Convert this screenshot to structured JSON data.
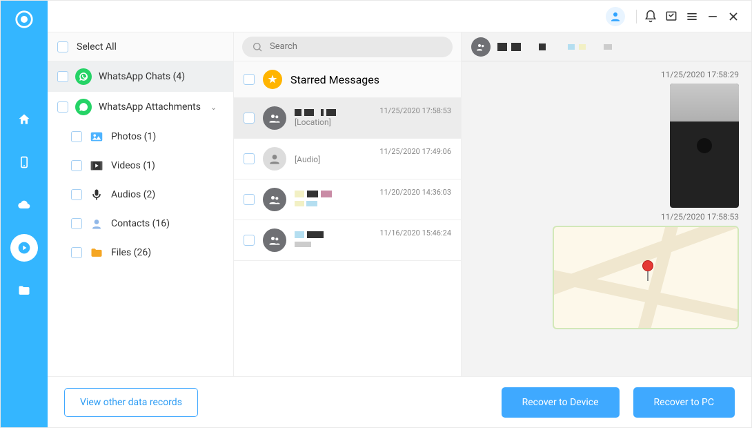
{
  "sidebar": {
    "select_all": "Select All",
    "categories": [
      {
        "label": "WhatsApp Chats (4)",
        "icon": "whatsapp"
      },
      {
        "label": "WhatsApp Attachments",
        "icon": "whatsapp",
        "expandable": true
      }
    ],
    "attachments": [
      {
        "label": "Photos (1)",
        "icon": "photos"
      },
      {
        "label": "Videos (1)",
        "icon": "videos"
      },
      {
        "label": "Audios (2)",
        "icon": "audios"
      },
      {
        "label": "Contacts (16)",
        "icon": "contacts"
      },
      {
        "label": "Files (26)",
        "icon": "files"
      }
    ]
  },
  "search": {
    "placeholder": "Search"
  },
  "chatlist": {
    "starred": "Starred Messages",
    "rows": [
      {
        "sub": "[Location]",
        "time": "11/25/2020 17:58:53",
        "group": true
      },
      {
        "sub": "[Audio]",
        "time": "11/25/2020 17:49:06",
        "group": false
      },
      {
        "sub": "",
        "time": "11/20/2020 14:36:03",
        "group": true
      },
      {
        "sub": "",
        "time": "11/16/2020 15:46:24",
        "group": true
      }
    ]
  },
  "detail": {
    "timestamps": [
      "11/25/2020 17:58:29",
      "11/25/2020 17:58:53"
    ]
  },
  "footer": {
    "view_other": "View other data records",
    "recover_device": "Recover to Device",
    "recover_pc": "Recover to PC"
  },
  "colors": {
    "accent": "#34b6ff",
    "whatsapp": "#25d366",
    "star": "#ffb400"
  }
}
